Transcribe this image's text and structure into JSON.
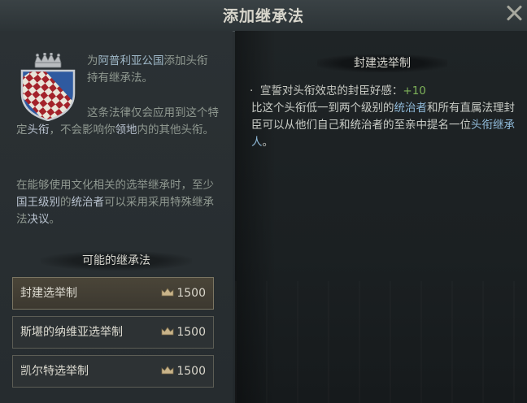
{
  "dialog": {
    "title": "添加继承法",
    "close_icon": "close-icon"
  },
  "left": {
    "coat_of_arms": "coat-of-arms-icon",
    "para1": {
      "prefix": "为",
      "highlight": "阿普利亚公国",
      "suffix": "添加头衔持有继承法。"
    },
    "para2": {
      "prefix": "这条法律仅会应用到这个特定",
      "highlight1": "头衔",
      "mid": "，不会影响你",
      "highlight2": "领地",
      "suffix": "内的其他头衔。"
    },
    "para3": {
      "prefix": "在能够使用文化相关的选举继承时，至少",
      "highlight1": "国王级别",
      "mid": "的",
      "highlight2": "统治者",
      "mid2": "可以采用采用特殊继承法",
      "highlight3": "决议",
      "suffix": "。"
    },
    "laws_header": "可能的继承法",
    "laws": [
      {
        "name": "封建选举制",
        "cost": "1500",
        "selected": true
      },
      {
        "name": "斯堪的纳维亚选举制",
        "cost": "1500",
        "selected": false
      },
      {
        "name": "凯尔特选举制",
        "cost": "1500",
        "selected": false
      }
    ],
    "cost_icon": "crown-icon"
  },
  "right": {
    "header": "封建选举制",
    "bullet": {
      "dot": "·",
      "text": "宣誓对头衔效忠的封臣好感：",
      "value": "+10"
    },
    "desc": {
      "part1": "比这个头衔低一到两个级别的",
      "link1": "统治者",
      "part2": "和所有直属法理封臣可以从他们自己和统治者的至亲中提名一位",
      "link2": "头衔继承人",
      "part3": "。"
    }
  },
  "colors": {
    "highlight_blue": "#9fb8c8",
    "positive_green": "#7fb35a",
    "selected_bg": "#4a4538"
  }
}
